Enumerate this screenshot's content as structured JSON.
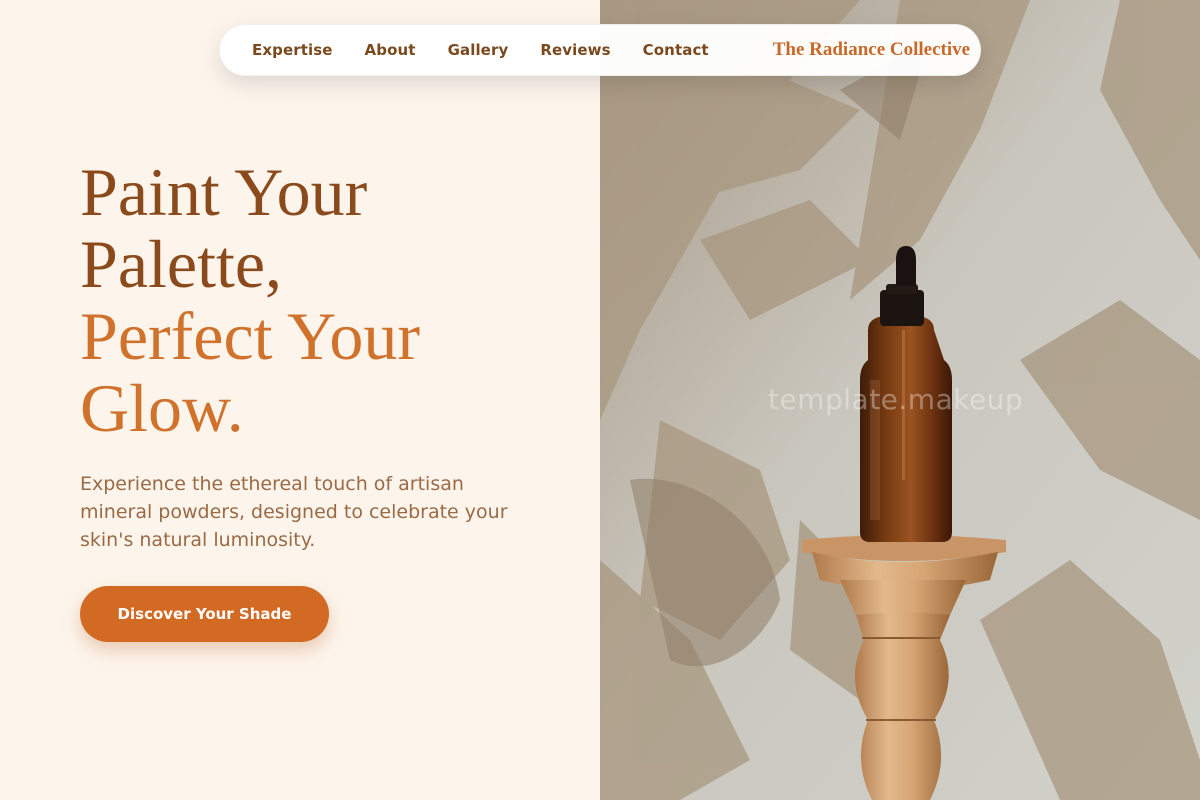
{
  "nav": {
    "links": [
      "Expertise",
      "About",
      "Gallery",
      "Reviews",
      "Contact"
    ],
    "brand": "The Radiance Collective"
  },
  "hero": {
    "title_lines": [
      "Paint Your",
      "Palette,"
    ],
    "title_accent_lines": [
      "Perfect Your",
      "Glow."
    ],
    "subtitle": "Experience the ethereal touch of artisan mineral powders, designed to celebrate your skin's natural luminosity.",
    "cta_label": "Discover Your Shade"
  },
  "image": {
    "watermark": "template.makeup"
  },
  "colors": {
    "background": "#fdf5ec",
    "heading_dark": "#8a4a1c",
    "heading_accent": "#d0722c",
    "body_text": "#9a6a45",
    "cta": "#d26a24",
    "brand": "#c8692a"
  }
}
